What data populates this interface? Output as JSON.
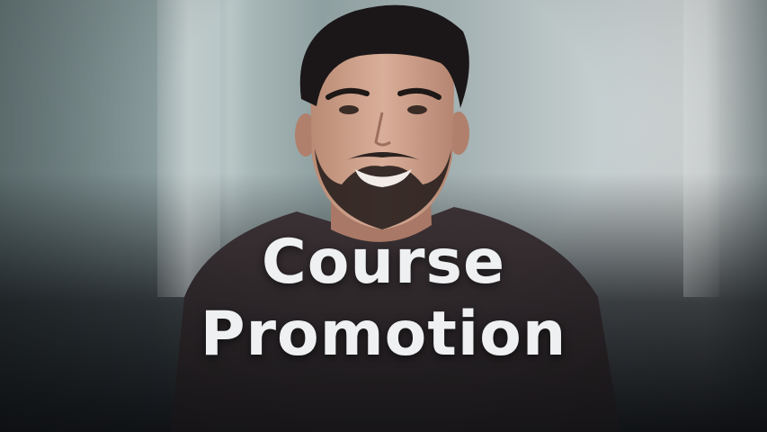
{
  "promo": {
    "title_line1": "Course",
    "title_line2": "Promotion"
  },
  "colors": {
    "background_top": "#8fa0a1",
    "background_bottom": "#15181c",
    "title_text": "#eef0f1",
    "shirt": "#2a2528"
  },
  "image": {
    "subject": "smiling-man-portrait-photo"
  }
}
